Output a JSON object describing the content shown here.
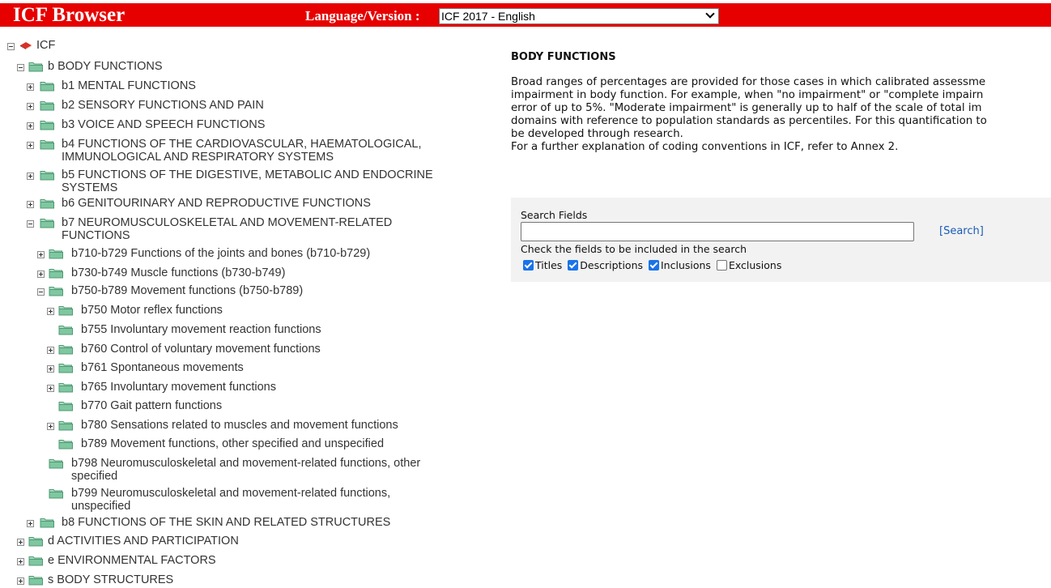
{
  "header": {
    "title": "ICF Browser",
    "language_label": "Language/Version :",
    "language_value": "ICF 2017 - English"
  },
  "tree": {
    "root": "ICF",
    "body_functions": "b BODY FUNCTIONS",
    "b1": "b1 MENTAL FUNCTIONS",
    "b2": "b2 SENSORY FUNCTIONS AND PAIN",
    "b3": "b3 VOICE AND SPEECH FUNCTIONS",
    "b4_line1": "b4 FUNCTIONS OF THE CARDIOVASCULAR, HAEMATOLOGICAL,",
    "b4_line2": "IMMUNOLOGICAL AND RESPIRATORY SYSTEMS",
    "b5_line1": "b5 FUNCTIONS OF THE DIGESTIVE, METABOLIC AND ENDOCRINE",
    "b5_line2": "SYSTEMS",
    "b6": "b6 GENITOURINARY AND REPRODUCTIVE FUNCTIONS",
    "b7_line1": "b7 NEUROMUSCULOSKELETAL AND MOVEMENT-RELATED",
    "b7_line2": "FUNCTIONS",
    "b710": "b710-b729 Functions of the joints and bones (b710-b729)",
    "b730": "b730-b749 Muscle functions (b730-b749)",
    "b750_group": "b750-b789 Movement functions (b750-b789)",
    "b750": "b750 Motor reflex functions",
    "b755": "b755 Involuntary movement reaction functions",
    "b760": "b760 Control of voluntary movement functions",
    "b761": "b761 Spontaneous movements",
    "b765": "b765 Involuntary movement functions",
    "b770": "b770 Gait pattern functions",
    "b780": "b780 Sensations related to muscles and movement functions",
    "b789": "b789 Movement functions, other specified and unspecified",
    "b798_line1": "b798 Neuromusculoskeletal and movement-related functions, other",
    "b798_line2": "specified",
    "b799_line1": "b799 Neuromusculoskeletal and movement-related functions,",
    "b799_line2": "unspecified",
    "b8": "b8 FUNCTIONS OF THE SKIN AND RELATED STRUCTURES",
    "d": "d ACTIVITIES AND PARTICIPATION",
    "e": "e ENVIRONMENTAL FACTORS",
    "s": "s BODY STRUCTURES"
  },
  "content": {
    "title": "BODY FUNCTIONS",
    "line1": "Broad ranges of percentages are provided for those cases in which calibrated assessme",
    "line2": "impairment in body function. For example, when \"no impairment\" or \"complete impairn",
    "line3": "error of up to 5%. \"Moderate impairment\" is generally up to half of the scale of total im",
    "line4": "domains with reference to population standards as percentiles. For this quantification to",
    "line5": "be developed through research.",
    "line6": "For a further explanation of coding conventions in ICF, refer to Annex 2."
  },
  "search": {
    "fields_label": "Search Fields",
    "input_value": "",
    "search_link": "[Search]",
    "hint": "Check the fields to be included in the search",
    "titles": "Titles",
    "descriptions": "Descriptions",
    "inclusions": "Inclusions",
    "exclusions": "Exclusions"
  },
  "colors": {
    "header_bg": "#e60000",
    "folder": "#7fc7a0",
    "link": "#1a5bb8",
    "checkbox": "#1a73e8"
  }
}
